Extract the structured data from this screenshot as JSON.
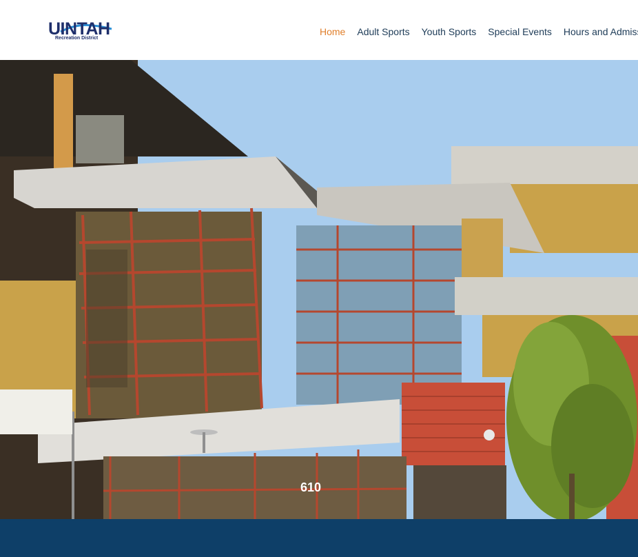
{
  "header": {
    "logo": {
      "wordmark": "UINTAH",
      "subtitle": "Recreation District"
    },
    "nav": [
      {
        "label": "Home",
        "active": true
      },
      {
        "label": "Adult Sports",
        "active": false
      },
      {
        "label": "Youth Sports",
        "active": false
      },
      {
        "label": "Special Events",
        "active": false
      },
      {
        "label": "Hours and Admissions",
        "active": false
      }
    ]
  },
  "hero": {
    "building_number": "610"
  },
  "colors": {
    "nav_text": "#1d3b57",
    "nav_active": "#e07f2b",
    "logo_blue": "#1f2f6b",
    "logo_swoosh": "#2a8fd6",
    "footer_band": "#0e3f68"
  }
}
